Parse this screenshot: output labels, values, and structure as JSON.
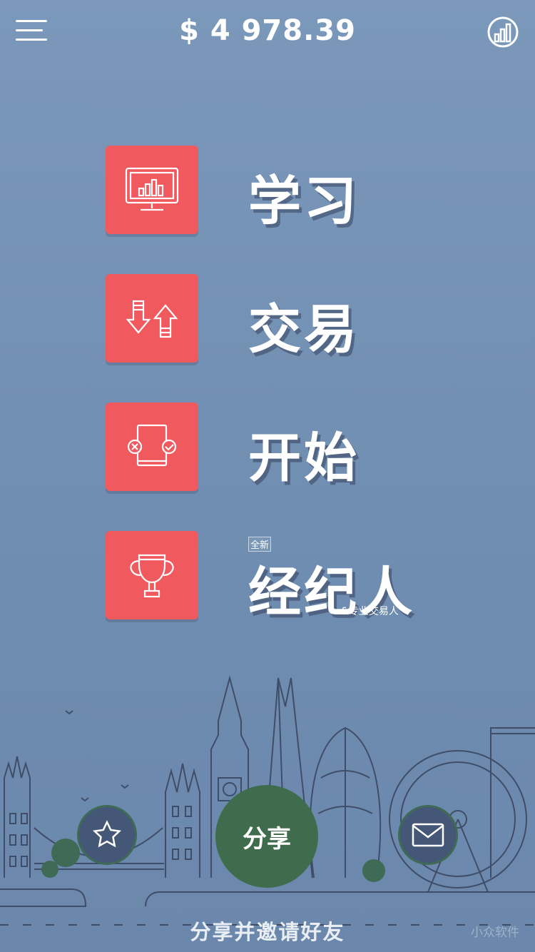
{
  "header": {
    "balance": "$ 4 978.39",
    "menu_icon": "hamburger-menu-icon",
    "stats_icon": "bar-chart-circle-icon"
  },
  "menu": [
    {
      "label": "学习",
      "icon": "monitor-chart-icon"
    },
    {
      "label": "交易",
      "icon": "up-down-arrows-icon"
    },
    {
      "label": "开始",
      "icon": "document-cross-check-icon"
    },
    {
      "label": "经纪人",
      "icon": "trophy-icon",
      "badge": "全新",
      "sublabel": "&专业交易人"
    }
  ],
  "actions": {
    "favorite_icon": "star-icon",
    "share_label": "分享",
    "mail_icon": "mail-icon"
  },
  "footer": {
    "text": "分享并邀请好友",
    "watermark": "小众软件"
  },
  "colors": {
    "background": "#7391b4",
    "tile": "#f05a5f",
    "share_button": "#3e6c4c",
    "round_button": "#455776"
  }
}
